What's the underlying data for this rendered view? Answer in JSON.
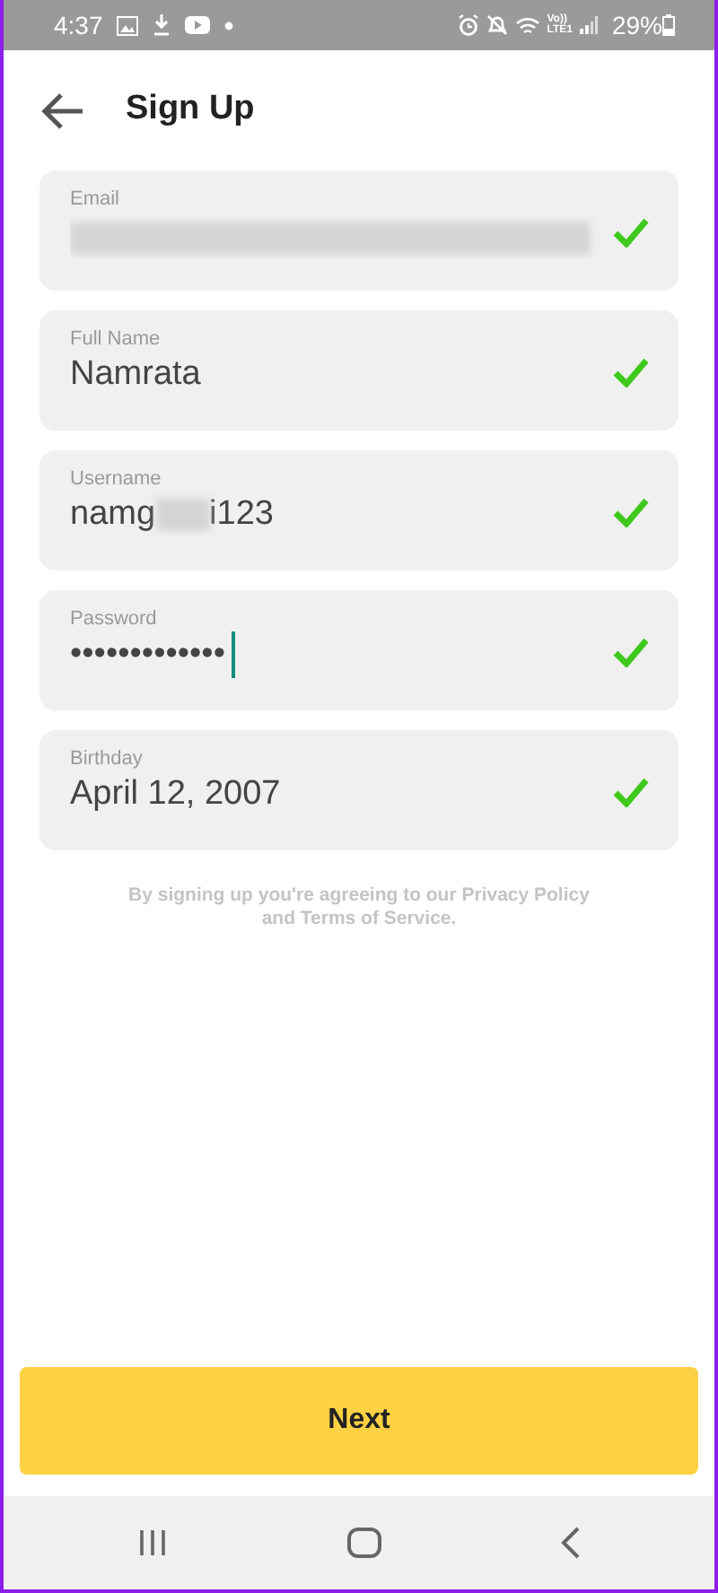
{
  "status_bar": {
    "time": "4:37",
    "network_top": "Vo))",
    "network_bottom": "LTE1",
    "battery": "29%"
  },
  "header": {
    "title": "Sign Up"
  },
  "fields": [
    {
      "label": "Email",
      "kind": "redacted",
      "valid": true,
      "focused": false
    },
    {
      "label": "Full Name",
      "kind": "text",
      "value": "Namrata",
      "valid": true,
      "focused": false
    },
    {
      "label": "Username",
      "kind": "partly_redacted",
      "value_start": "namg",
      "value_end": "i123",
      "valid": true,
      "focused": false
    },
    {
      "label": "Password",
      "kind": "text",
      "value": "•••••••••••••",
      "valid": true,
      "focused": true
    },
    {
      "label": "Birthday",
      "kind": "text",
      "value": "April 12, 2007",
      "valid": true,
      "focused": false
    }
  ],
  "terms": "By signing up you're agreeing to our Privacy Policy and Terms of Service.",
  "next_button": "Next"
}
